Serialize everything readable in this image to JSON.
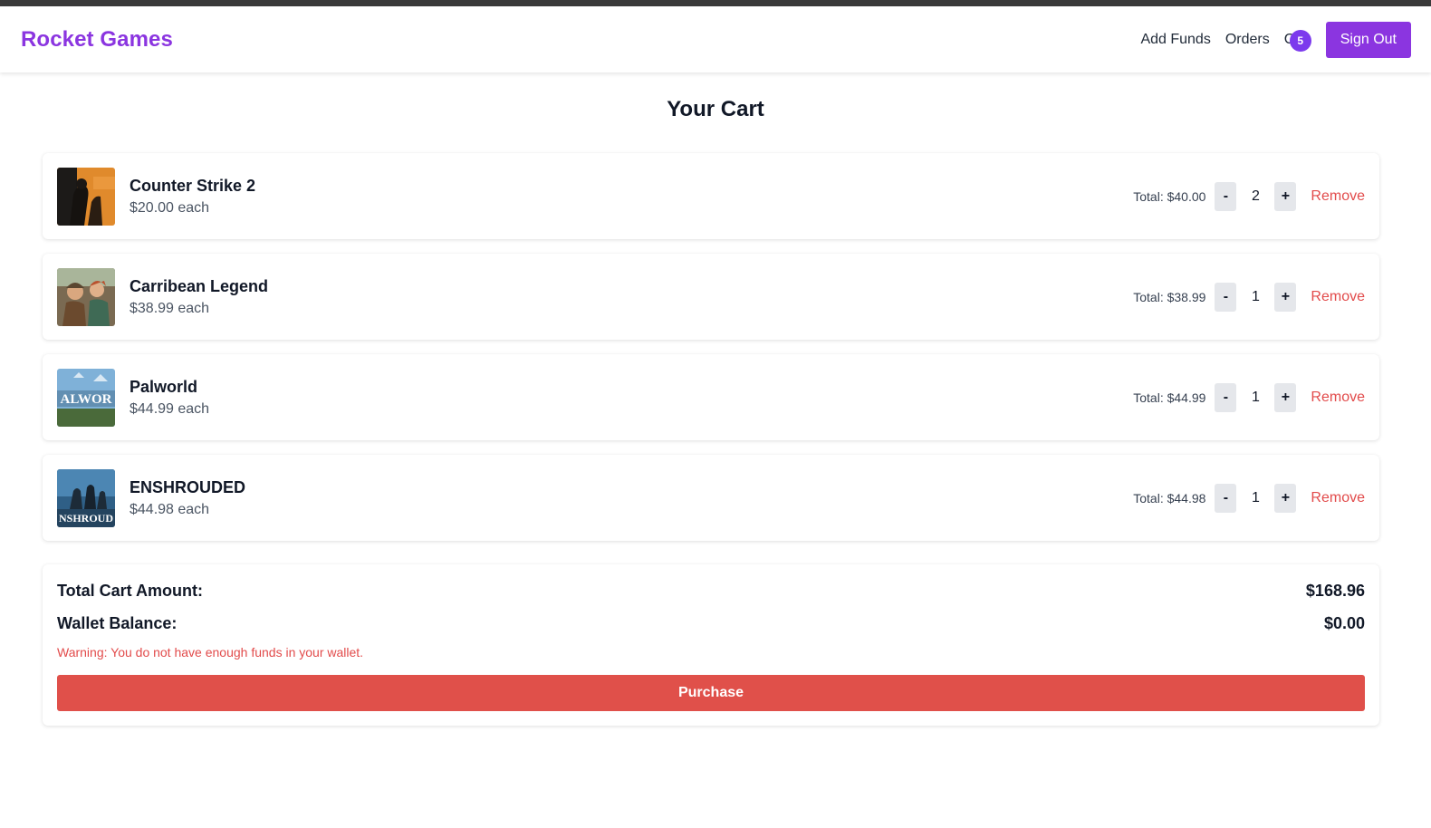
{
  "brand": "Rocket Games",
  "nav": {
    "add_funds": "Add Funds",
    "orders": "Orders",
    "cart_label": "C",
    "cart_count": "5",
    "sign_out": "Sign Out"
  },
  "page_title": "Your Cart",
  "items": [
    {
      "name": "Counter Strike 2",
      "unit_price": "$20.00 each",
      "total": "Total: $40.00",
      "qty": "2",
      "minus": "-",
      "plus": "+",
      "remove": "Remove",
      "thumb_text": ""
    },
    {
      "name": "Carribean Legend",
      "unit_price": "$38.99 each",
      "total": "Total: $38.99",
      "qty": "1",
      "minus": "-",
      "plus": "+",
      "remove": "Remove",
      "thumb_text": ""
    },
    {
      "name": "Palworld",
      "unit_price": "$44.99 each",
      "total": "Total: $44.99",
      "qty": "1",
      "minus": "-",
      "plus": "+",
      "remove": "Remove",
      "thumb_text": "ALWOR"
    },
    {
      "name": "ENSHROUDED",
      "unit_price": "$44.98 each",
      "total": "Total: $44.98",
      "qty": "1",
      "minus": "-",
      "plus": "+",
      "remove": "Remove",
      "thumb_text": "NSHROUD"
    }
  ],
  "summary": {
    "total_label": "Total Cart Amount:",
    "total_value": "$168.96",
    "wallet_label": "Wallet Balance:",
    "wallet_value": "$0.00",
    "warning": "Warning: You do not have enough funds in your wallet.",
    "purchase": "Purchase"
  },
  "colors": {
    "brand": "#8b35e0",
    "danger": "#e0504a",
    "badge": "#7c3aed"
  }
}
